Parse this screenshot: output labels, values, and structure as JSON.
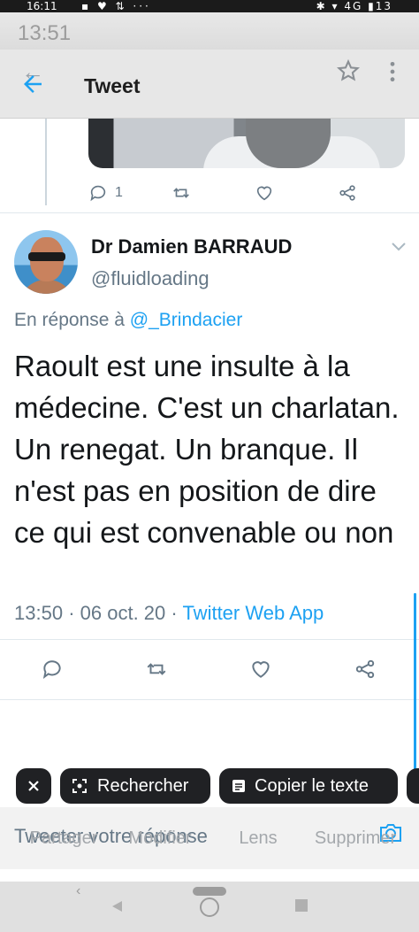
{
  "status_bar": {
    "time": "16:11",
    "time_ghost": "13:51",
    "icons_left": "▪ ♥ ⇅ ···",
    "network": "4G",
    "battery": "13"
  },
  "header": {
    "title": "Tweet"
  },
  "previous_tweet": {
    "reply_count": "1"
  },
  "tweet": {
    "author_name": "Dr Damien BARRAUD",
    "author_handle": "@fluidloading",
    "reply_prefix": "En réponse à",
    "reply_mention": "@_Brindacier",
    "text": "Raoult est une insulte à la médecine. C'est un charlatan. Un renegat. Un branque. Il n'est pas en position de dire ce qui est convenable ou non",
    "time": "13:50",
    "separator": "·",
    "date": "06 oct. 20",
    "app": "Twitter Web App"
  },
  "lens_bar": {
    "search_label": "Rechercher",
    "copy_label": "Copier le texte"
  },
  "compose": {
    "placeholder": "Tweeter votre réponse"
  },
  "edit_bar": {
    "share": "Partager",
    "edit": "Modifier",
    "lens": "Lens",
    "delete": "Supprimer"
  },
  "colors": {
    "accent": "#1da1f2",
    "secondary_text": "#657786",
    "primary_text": "#14171a"
  }
}
